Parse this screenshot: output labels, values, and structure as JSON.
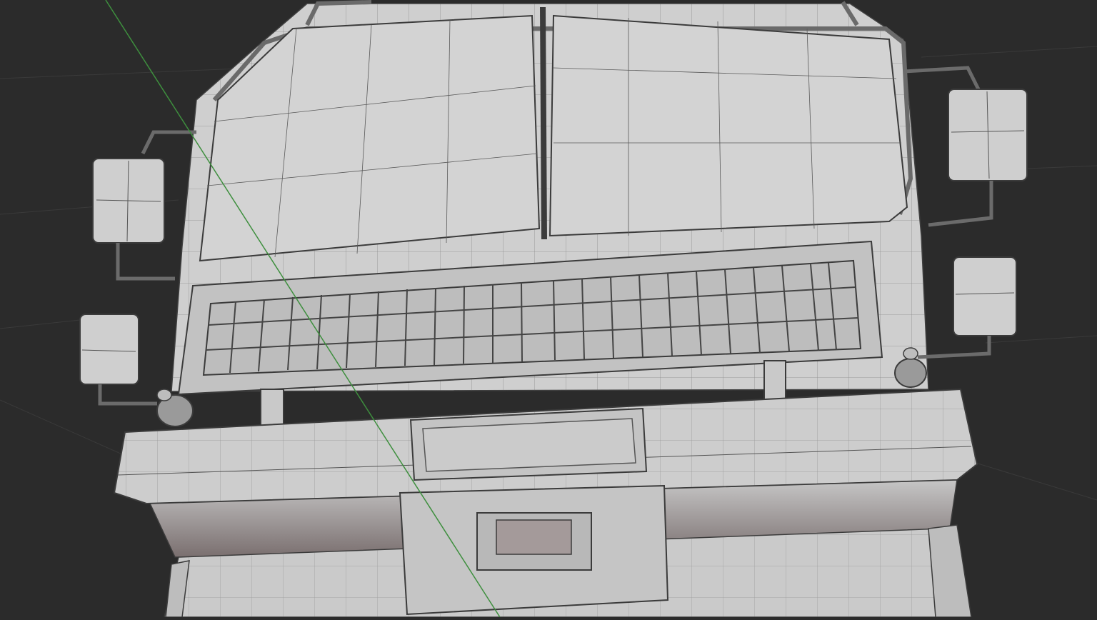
{
  "viewport": {
    "view_mode": "wireframe-on-shaded",
    "background_color": "#2a2a2a",
    "grid_line_color": "#3a3a3a",
    "mesh_surface_color": "#c9c9c9",
    "mesh_wire_color": "#3b3b3b",
    "shadow_color": "#7d7272",
    "axis_line": {
      "axis": "y",
      "color": "#3e8f3e"
    }
  },
  "model": {
    "subject": "truck-cab-front",
    "parts": [
      "cab-roof",
      "windshield-left",
      "windshield-right",
      "roof-rail",
      "mirror-left-upper",
      "mirror-left-lower",
      "mirror-right-upper",
      "mirror-right-lower",
      "front-grille",
      "bumper",
      "headlight-left",
      "headlight-right",
      "license-plate-recess",
      "tow-hook-recess",
      "front-step"
    ]
  }
}
